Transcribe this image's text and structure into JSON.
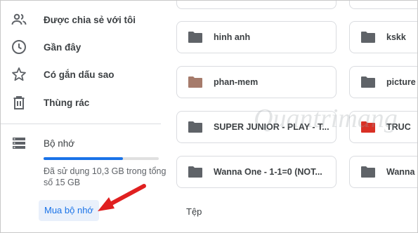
{
  "sidebar": {
    "items": [
      {
        "label": "Được chia sẻ với tôi",
        "icon": "shared-people-icon"
      },
      {
        "label": "Gần đây",
        "icon": "clock-icon"
      },
      {
        "label": "Có gắn dấu sao",
        "icon": "star-icon"
      },
      {
        "label": "Thùng rác",
        "icon": "trash-icon"
      }
    ],
    "storage": {
      "label": "Bộ nhớ",
      "icon": "storage-icon",
      "used_text": "Đã sử dụng 10,3 GB trong tổng số 15 GB",
      "used_fraction": 0.687,
      "buy_label": "Mua bộ nhớ"
    }
  },
  "folders": [
    {
      "name": "hinh anh",
      "color": "#5f6368"
    },
    {
      "name": "kskk",
      "color": "#5f6368"
    },
    {
      "name": "phan-mem",
      "color": "#a67b6b"
    },
    {
      "name": "picture",
      "color": "#5f6368"
    },
    {
      "name": "SUPER JUNIOR - PLAY - T...",
      "color": "#5f6368"
    },
    {
      "name": "TRUC",
      "color": "#d93025"
    },
    {
      "name": "Wanna One - 1-1=0 (NOT...",
      "color": "#5f6368"
    },
    {
      "name": "Wanna",
      "color": "#5f6368"
    }
  ],
  "files_section_title": "Tệp",
  "watermark_text": "Quantrimang",
  "colors": {
    "accent": "#1a73e8",
    "annotation_arrow": "#e02020"
  }
}
